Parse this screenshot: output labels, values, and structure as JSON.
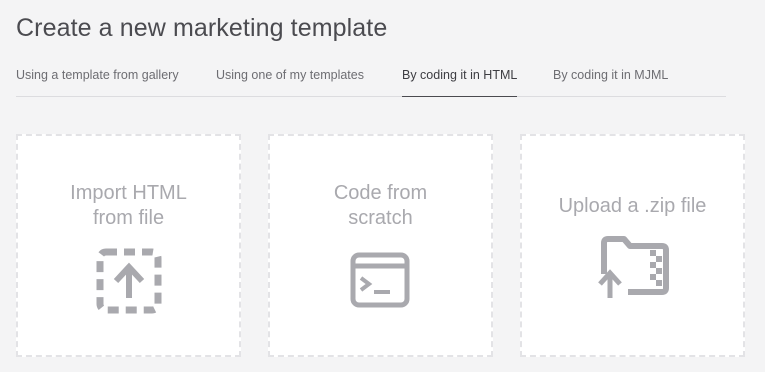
{
  "header": {
    "title": "Create a new marketing template"
  },
  "tabs": [
    {
      "label": "Using a template from gallery",
      "active": false
    },
    {
      "label": "Using one of my templates",
      "active": false
    },
    {
      "label": "By coding it in HTML",
      "active": true
    },
    {
      "label": "By coding it in MJML",
      "active": false
    }
  ],
  "cards": [
    {
      "label_line1": "Import HTML",
      "label_line2": "from file",
      "icon": "upload-dashed-icon"
    },
    {
      "label_line1": "Code from",
      "label_line2": "scratch",
      "icon": "terminal-window-icon"
    },
    {
      "label_line1": "Upload a .zip file",
      "label_line2": "",
      "icon": "zip-folder-upload-icon"
    }
  ],
  "colors": {
    "background": "#f4f4f5",
    "card": "#ffffff",
    "icon": "#a9a9ae",
    "text": "#4b4b50"
  }
}
